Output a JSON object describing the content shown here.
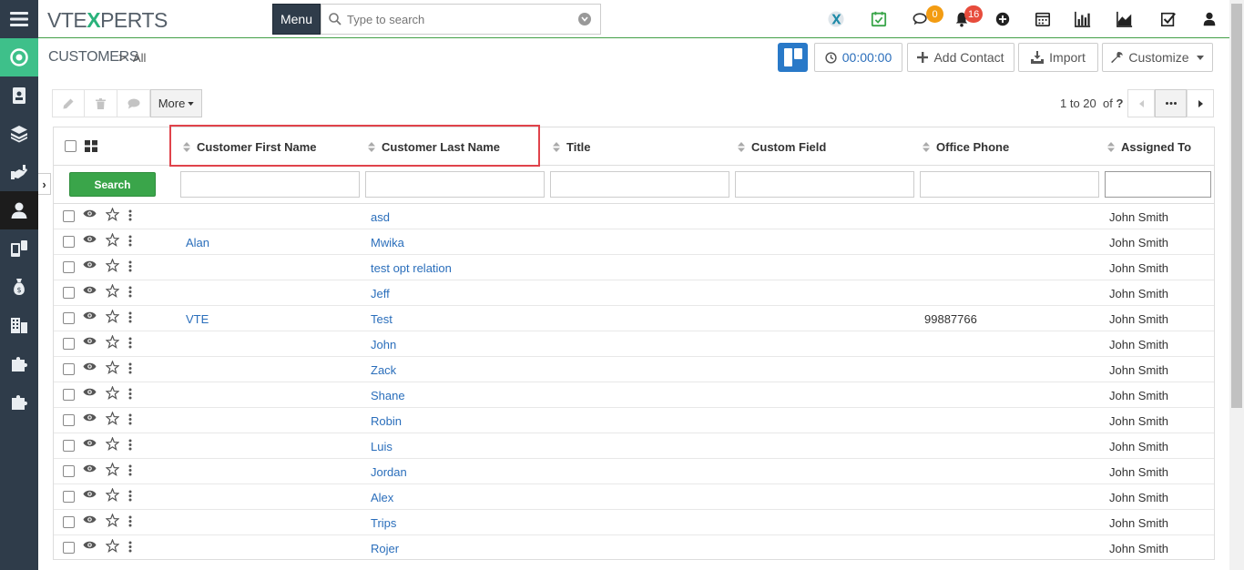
{
  "app": {
    "logo_pre": "VTE",
    "logo_x": "X",
    "logo_post": "PERTS",
    "menu_label": "Menu",
    "search_placeholder": "Type to search"
  },
  "notifications": {
    "chat_count": "0",
    "chat_color": "#f39c12",
    "bell_count": "16",
    "bell_color": "#e74c3c"
  },
  "breadcrumb": {
    "module": "CUSTOMERS",
    "separator": ">",
    "filter": "All"
  },
  "header_buttons": {
    "timer": "00:00:00",
    "add_contact": "Add Contact",
    "import": "Import",
    "customize": "Customize"
  },
  "toolbar": {
    "more_label": "More"
  },
  "pager": {
    "range": "1 to 20",
    "of": "of",
    "total": "?"
  },
  "table": {
    "columns": [
      "Customer First Name",
      "Customer Last Name",
      "Title",
      "Custom Field",
      "Office Phone",
      "Assigned To"
    ],
    "search_label": "Search",
    "rows": [
      {
        "first": "",
        "last": "asd",
        "title": "",
        "custom": "",
        "phone": "",
        "assigned": "John Smith"
      },
      {
        "first": "Alan",
        "last": "Mwika",
        "title": "",
        "custom": "",
        "phone": "",
        "assigned": "John Smith"
      },
      {
        "first": "",
        "last": "test opt relation",
        "title": "",
        "custom": "",
        "phone": "",
        "assigned": "John Smith"
      },
      {
        "first": "",
        "last": "Jeff",
        "title": "",
        "custom": "",
        "phone": "",
        "assigned": "John Smith"
      },
      {
        "first": "VTE",
        "last": "Test",
        "title": "",
        "custom": "",
        "phone": "99887766",
        "assigned": "John Smith"
      },
      {
        "first": "",
        "last": "John",
        "title": "",
        "custom": "",
        "phone": "",
        "assigned": "John Smith"
      },
      {
        "first": "",
        "last": "Zack",
        "title": "",
        "custom": "",
        "phone": "",
        "assigned": "John Smith"
      },
      {
        "first": "",
        "last": "Shane",
        "title": "",
        "custom": "",
        "phone": "",
        "assigned": "John Smith"
      },
      {
        "first": "",
        "last": "Robin",
        "title": "",
        "custom": "",
        "phone": "",
        "assigned": "John Smith"
      },
      {
        "first": "",
        "last": "Luis",
        "title": "",
        "custom": "",
        "phone": "",
        "assigned": "John Smith"
      },
      {
        "first": "",
        "last": "Jordan",
        "title": "",
        "custom": "",
        "phone": "",
        "assigned": "John Smith"
      },
      {
        "first": "",
        "last": "Alex",
        "title": "",
        "custom": "",
        "phone": "",
        "assigned": "John Smith"
      },
      {
        "first": "",
        "last": "Trips",
        "title": "",
        "custom": "",
        "phone": "",
        "assigned": "John Smith"
      },
      {
        "first": "",
        "last": "Rojer",
        "title": "",
        "custom": "",
        "phone": "",
        "assigned": "John Smith"
      }
    ]
  },
  "colors": {
    "sidebar_bg": "#2f3c4a",
    "accent_green": "#3ec08a",
    "link_blue": "#2a6ebb",
    "highlight_red": "#e0434b",
    "kanban_blue": "#2979c8"
  }
}
